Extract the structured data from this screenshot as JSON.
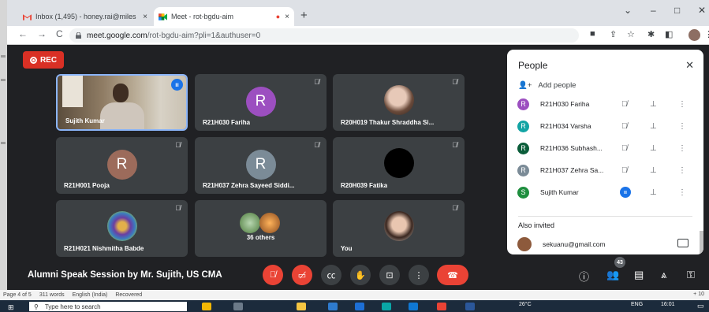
{
  "browser": {
    "tabs": [
      {
        "title": "Inbox (1,495) - honey.rai@miles",
        "close": "×",
        "active": false
      },
      {
        "title": "Meet - rot-bgdu-aim",
        "close": "×",
        "active": true
      }
    ],
    "new_tab": "+",
    "window_controls": [
      "⌄",
      "–",
      "□",
      "✕"
    ],
    "url_host": "meet.google.com",
    "url_rest": "/rot-bgdu-aim?pli=1&authuser=0",
    "nav": {
      "back": "←",
      "forward": "→",
      "reload": "C"
    }
  },
  "meet": {
    "rec_label": "REC",
    "meeting_title": "Alumni Speak Session by Mr. Sujith, US CMA",
    "participant_count": "43",
    "tiles": [
      {
        "name": "Sujith Kumar",
        "kind": "video"
      },
      {
        "name": "R21H030 Fariha",
        "initial": "R",
        "color": "#9c4fc0"
      },
      {
        "name": "R20H019 Thakur Shraddha Si...",
        "kind": "photo"
      },
      {
        "name": "R21H001 Pooja",
        "initial": "R",
        "color": "#9c6b5b"
      },
      {
        "name": "R21H037 Zehra Sayeed Siddi...",
        "initial": "R",
        "color": "#7b8b97"
      },
      {
        "name": "R20H039 Fatika",
        "kind": "photo"
      },
      {
        "name": "R21H021 Nishmitha Babde",
        "kind": "photo"
      },
      {
        "name": "36 others",
        "kind": "others"
      },
      {
        "name": "You",
        "kind": "photo"
      }
    ],
    "people_panel": {
      "title": "People",
      "add_people": "Add people",
      "participants": [
        {
          "name": "R21H030 Fariha",
          "initial": "R",
          "color": "#9c4fc0"
        },
        {
          "name": "R21H034 Varsha",
          "initial": "R",
          "color": "#12a4a4"
        },
        {
          "name": "R21H036 Subhash...",
          "initial": "R",
          "color": "#0b5d3a"
        },
        {
          "name": "R21H037 Zehra Sa...",
          "initial": "R",
          "color": "#7b8b97"
        },
        {
          "name": "Sujith Kumar",
          "initial": "S",
          "color": "#1e8e3e"
        }
      ],
      "also_invited_label": "Also invited",
      "invited_email": "sekuanu@gmail.com"
    }
  },
  "word_status": {
    "page": "Page 4 of 5",
    "words": "311 words",
    "language": "English (India)",
    "recovered": "Recovered",
    "zoom": "+ 10"
  },
  "taskbar": {
    "search_placeholder": "Type here to search",
    "weather": "26°C",
    "lang": "ENG",
    "time": "16:01"
  }
}
